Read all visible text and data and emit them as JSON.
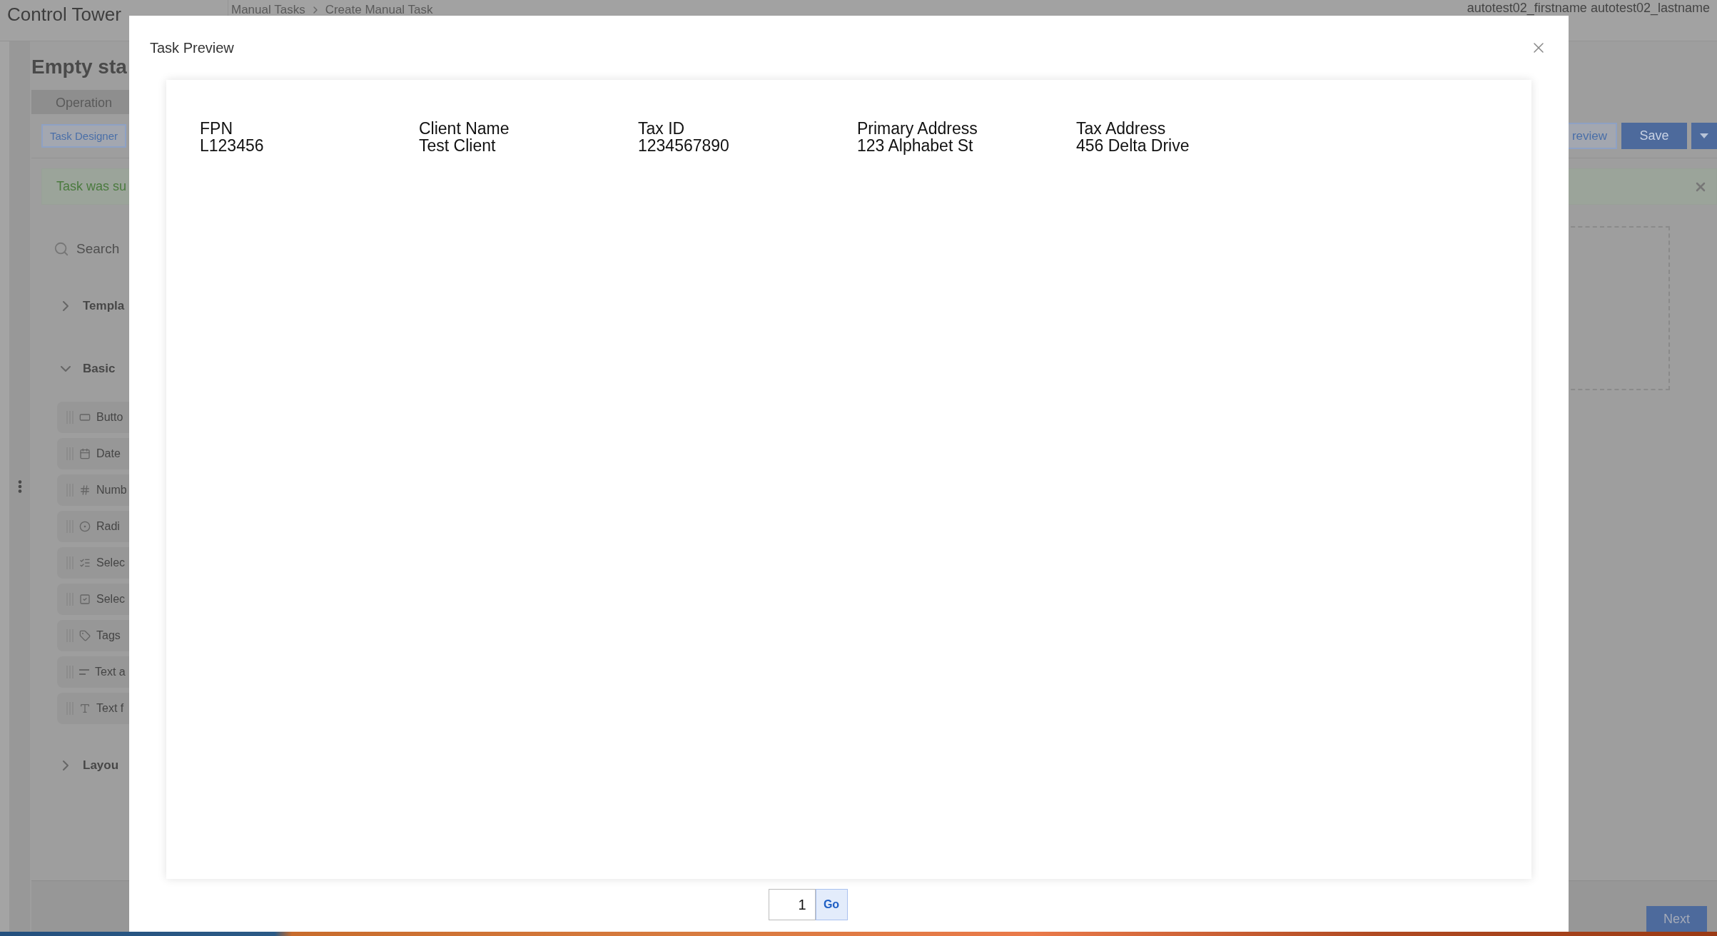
{
  "app": {
    "title": "Control Tower",
    "breadcrumb": [
      "Manual Tasks",
      "Create Manual Task"
    ],
    "user": "autotest02_firstname autotest02_lastname",
    "page_title": "Empty sta",
    "tabs": [
      {
        "label": "Operation",
        "selected": true
      }
    ],
    "toolbar": {
      "designer_button": "Task Designer",
      "preview_button": "review",
      "save_button": "Save"
    },
    "alert": "Task was su",
    "search": {
      "placeholder": "Search"
    },
    "groups": [
      {
        "label": "Templa",
        "expanded": false
      },
      {
        "label": "Basic",
        "expanded": true,
        "items": [
          {
            "kind": "button",
            "label": "Butto"
          },
          {
            "kind": "date",
            "label": "Date"
          },
          {
            "kind": "number",
            "label": "Numb"
          },
          {
            "kind": "radio",
            "label": "Radi"
          },
          {
            "kind": "select",
            "label": "Selec"
          },
          {
            "kind": "checkbox",
            "label": "Selec"
          },
          {
            "kind": "tags",
            "label": "Tags"
          },
          {
            "kind": "textarea",
            "label": "Text a"
          },
          {
            "kind": "textfield",
            "label": "Text f"
          }
        ]
      },
      {
        "label": "Layou",
        "expanded": false
      }
    ],
    "next_button": "Next"
  },
  "modal": {
    "title": "Task Preview",
    "fields": [
      {
        "label": "FPN",
        "value": "L123456"
      },
      {
        "label": "Client Name",
        "value": "Test Client"
      },
      {
        "label": "Tax ID",
        "value": "1234567890"
      },
      {
        "label": "Primary Address",
        "value": "123 Alphabet St"
      },
      {
        "label": "Tax Address",
        "value": "456 Delta Drive"
      }
    ],
    "pager": {
      "value": "1",
      "button": "Go"
    }
  }
}
